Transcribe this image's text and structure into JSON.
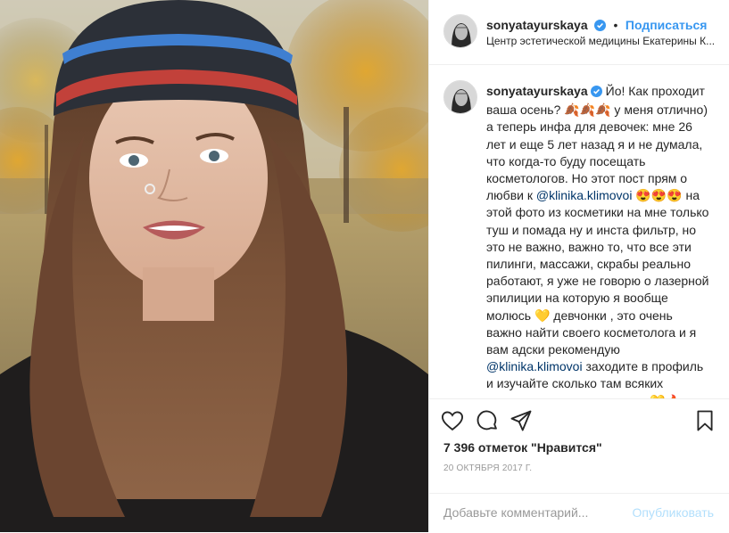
{
  "post": {
    "username": "sonyatayurskaya",
    "follow_label": "Подписаться",
    "separator": "•",
    "location": "Центр эстетической медицины Екатерины К...",
    "caption_parts": [
      "Йо! Как проходит ваша осень? ",
      "🍂🍂🍂",
      " у меня отлично) а теперь инфа для девочек: мне 26 лет и еще 5 лет назад я и не думала, что когда-то буду посещать косметологов. Но этот пост прям о любви к ",
      "@klinika.klimovoi",
      " 😍😍😍 на этой фото из косметики на мне только туш и помада ну и инста фильтр, но это не важно, важно то, что все эти пилинги, массажи, скрабы реально работают, я уже не говорю о лазерной эпилиции на которую я вообще молюсь 💛 девчонки , это очень важно найти своего косметолога и я вам адски рекомендую ",
      "@klinika.klimovoi",
      " заходите в профиль и изучайте сколько там всяких приятных, крутых процедур 💛🔥"
    ],
    "likes": "7 396 отметок \"Нравится\"",
    "date": "20 ОКТЯБРЯ 2017 Г.",
    "comment_placeholder": "Добавьте комментарий...",
    "post_button": "Опубликовать"
  },
  "icons": {
    "like": "heart-icon",
    "comment": "comment-icon",
    "share": "share-icon",
    "save": "bookmark-icon",
    "verified": "verified-badge-icon"
  },
  "colors": {
    "accent": "#3897f0",
    "text": "#262626",
    "muted": "#999999",
    "border": "#efefef",
    "post_disabled": "#b2dffc"
  }
}
